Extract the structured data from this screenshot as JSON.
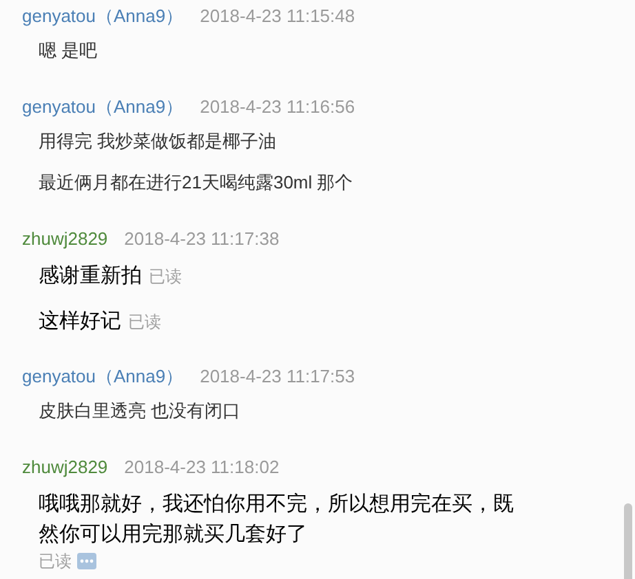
{
  "messages": [
    {
      "kind": "other",
      "sender": "genyatou",
      "alias": "（Anna9）",
      "time": "2018-4-23 11:15:48",
      "lines": [
        {
          "text": "嗯 是吧"
        }
      ]
    },
    {
      "kind": "other",
      "sender": "genyatou",
      "alias": "（Anna9）",
      "time": "2018-4-23 11:16:56",
      "lines": [
        {
          "text": "用得完 我炒菜做饭都是椰子油"
        },
        {
          "text": "最近俩月都在进行21天喝纯露30ml 那个"
        }
      ]
    },
    {
      "kind": "self",
      "sender": "zhuwj2829",
      "time": "2018-4-23 11:17:38",
      "lines": [
        {
          "text": "感谢重新拍",
          "read": "已读",
          "read_below": false
        },
        {
          "text": "这样好记",
          "read": "已读",
          "read_below": false
        }
      ]
    },
    {
      "kind": "other",
      "sender": "genyatou",
      "alias": "（Anna9）",
      "time": "2018-4-23 11:17:53",
      "lines": [
        {
          "text": "皮肤白里透亮 也没有闭口"
        }
      ]
    },
    {
      "kind": "self",
      "sender": "zhuwj2829",
      "time": "2018-4-23 11:18:02",
      "lines": [
        {
          "text": "哦哦那就好，我还怕你用不完，所以想用完在买，既然你可以用完那就买几套好了",
          "read": "已读",
          "read_below": true
        }
      ]
    }
  ]
}
